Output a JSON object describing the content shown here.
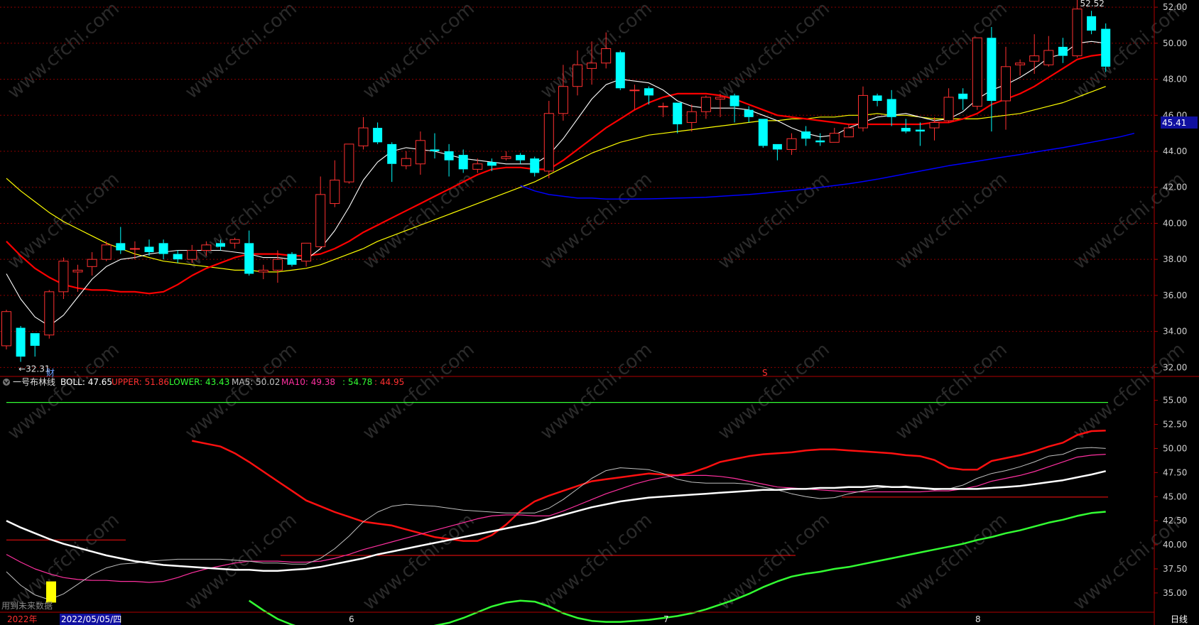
{
  "colors": {
    "background": "#000000",
    "up": "#ff3030",
    "down": "#00ffff",
    "grid": "#8b0000",
    "frame": "#b00000",
    "ma5": "#ffffff",
    "ma10": "#ff0000",
    "ma20": "#ffff00",
    "ma60": "#0000ff",
    "boll": "#ffffff",
    "upper": "#ff1010",
    "lower": "#33ff33",
    "bma5": "#c0c0c0",
    "bma10": "#ff30a0",
    "price_tag_bg": "#1010a0"
  },
  "watermark": "www.cfchi.com",
  "price_axis": {
    "ticks": [
      "32.00",
      "34.00",
      "36.00",
      "38.00",
      "40.00",
      "42.00",
      "44.00",
      "46.00",
      "48.00",
      "50.00",
      "52.00"
    ],
    "current_price": "45.41"
  },
  "boll_axis": {
    "ticks": [
      "35.00",
      "37.50",
      "40.00",
      "42.50",
      "45.00",
      "47.50",
      "50.00",
      "52.50",
      "55.00"
    ]
  },
  "annotations": {
    "high_label": "52.52",
    "low_label": "←32.31",
    "fin_marker": "财",
    "s_marker": "S"
  },
  "indicator_bar": {
    "name": "一号布林线",
    "boll": "BOLL: 47.65",
    "upper": "UPPER: 51.86",
    "lower": "LOWER: 43.43",
    "ma5": "MA5: 50.02",
    "ma10": "MA10: 49.38",
    "v1": ": 54.78",
    "v2": ": 44.95"
  },
  "bottom_axis": {
    "year_label": "2022年",
    "cursor_date": "2022/05/05/四",
    "months": [
      "6",
      "7",
      "8"
    ],
    "period": "日线",
    "overlay_text": "用到未来数据"
  },
  "chart_data": [
    {
      "type": "candlestick",
      "name": "main",
      "ylim": [
        31.5,
        52.4
      ],
      "candles": [
        [
          33.2,
          35.1,
          35.2,
          33.0
        ],
        [
          34.2,
          32.6,
          34.3,
          32.31
        ],
        [
          33.9,
          33.2,
          33.9,
          32.6
        ],
        [
          33.8,
          36.2,
          36.3,
          33.6
        ],
        [
          36.2,
          37.9,
          38.1,
          35.8
        ],
        [
          37.3,
          37.4,
          37.7,
          36.2
        ],
        [
          37.6,
          38.0,
          38.4,
          37.1
        ],
        [
          38.0,
          38.8,
          39.0,
          37.9
        ],
        [
          38.9,
          38.5,
          39.8,
          38.3
        ],
        [
          38.6,
          38.6,
          39.0,
          38.0
        ],
        [
          38.7,
          38.4,
          39.1,
          38.2
        ],
        [
          38.9,
          38.3,
          39.1,
          38.0
        ],
        [
          38.3,
          38.0,
          38.5,
          37.8
        ],
        [
          38.0,
          38.5,
          38.8,
          37.8
        ],
        [
          38.5,
          38.8,
          39.0,
          38.2
        ],
        [
          38.9,
          38.7,
          39.1,
          38.5
        ],
        [
          38.9,
          39.1,
          39.2,
          38.6
        ],
        [
          38.9,
          37.2,
          39.6,
          37.1
        ],
        [
          37.3,
          37.4,
          37.7,
          36.9
        ],
        [
          37.4,
          38.0,
          38.5,
          36.7
        ],
        [
          38.3,
          37.7,
          38.4,
          37.6
        ],
        [
          37.9,
          38.9,
          38.9,
          37.6
        ],
        [
          38.7,
          41.6,
          42.6,
          38.6
        ],
        [
          41.1,
          42.4,
          43.5,
          40.9
        ],
        [
          42.3,
          44.4,
          44.4,
          42.2
        ],
        [
          44.3,
          45.3,
          45.9,
          44.1
        ],
        [
          45.3,
          44.5,
          45.6,
          44.4
        ],
        [
          44.4,
          43.3,
          44.5,
          42.3
        ],
        [
          43.2,
          43.6,
          44.0,
          43.0
        ],
        [
          43.3,
          44.6,
          45.1,
          42.7
        ],
        [
          44.1,
          44.0,
          45.0,
          43.6
        ],
        [
          44.0,
          43.5,
          44.4,
          42.6
        ],
        [
          43.8,
          43.0,
          44.1,
          42.8
        ],
        [
          43.0,
          43.3,
          43.6,
          42.8
        ],
        [
          43.4,
          43.2,
          43.6,
          42.9
        ],
        [
          43.6,
          43.7,
          44.0,
          43.5
        ],
        [
          43.8,
          43.5,
          43.9,
          43.3
        ],
        [
          43.6,
          42.8,
          43.7,
          42.6
        ],
        [
          42.9,
          46.1,
          46.8,
          42.5
        ],
        [
          46.1,
          47.6,
          48.8,
          45.7
        ],
        [
          47.6,
          48.8,
          49.6,
          47.1
        ],
        [
          48.6,
          48.9,
          50.1,
          47.7
        ],
        [
          48.9,
          49.7,
          50.6,
          48.6
        ],
        [
          49.5,
          47.5,
          49.6,
          47.4
        ],
        [
          47.4,
          47.4,
          47.7,
          46.3
        ],
        [
          47.5,
          47.1,
          47.6,
          46.6
        ],
        [
          46.5,
          46.5,
          46.7,
          45.9
        ],
        [
          46.7,
          45.5,
          46.7,
          45.0
        ],
        [
          45.6,
          46.2,
          46.6,
          45.1
        ],
        [
          46.2,
          47.0,
          47.1,
          45.8
        ],
        [
          46.9,
          47.0,
          47.2,
          45.9
        ],
        [
          47.1,
          46.5,
          47.2,
          45.6
        ],
        [
          46.3,
          45.9,
          46.5,
          45.6
        ],
        [
          45.8,
          44.3,
          45.8,
          44.2
        ],
        [
          44.4,
          44.1,
          44.4,
          43.5
        ],
        [
          44.1,
          44.7,
          45.0,
          43.8
        ],
        [
          45.1,
          44.7,
          45.4,
          44.3
        ],
        [
          44.6,
          44.5,
          45.0,
          44.3
        ],
        [
          44.5,
          45.0,
          45.3,
          44.5
        ],
        [
          44.8,
          45.3,
          45.5,
          44.8
        ],
        [
          45.3,
          47.1,
          47.6,
          45.1
        ],
        [
          47.1,
          46.8,
          47.2,
          46.5
        ],
        [
          46.9,
          45.9,
          47.4,
          45.4
        ],
        [
          45.3,
          45.1,
          45.8,
          45.0
        ],
        [
          45.2,
          45.1,
          45.6,
          44.3
        ],
        [
          45.3,
          45.6,
          45.9,
          44.6
        ],
        [
          45.7,
          47.0,
          47.5,
          45.6
        ],
        [
          47.2,
          46.9,
          47.5,
          46.3
        ],
        [
          46.5,
          50.3,
          50.3,
          46.3
        ],
        [
          50.3,
          46.8,
          50.9,
          45.1
        ],
        [
          46.8,
          48.7,
          49.8,
          45.2
        ],
        [
          48.8,
          48.9,
          49.1,
          48.2
        ],
        [
          49.0,
          49.3,
          50.5,
          48.3
        ],
        [
          48.8,
          49.6,
          50.4,
          48.7
        ],
        [
          49.8,
          49.3,
          50.3,
          48.9
        ],
        [
          49.3,
          51.9,
          52.52,
          49.2
        ],
        [
          51.5,
          50.7,
          51.8,
          50.5
        ],
        [
          50.8,
          48.7,
          51.1,
          48.4
        ]
      ],
      "ma5": [
        37.2,
        35.8,
        34.8,
        34.3,
        34.9,
        35.9,
        36.9,
        37.6,
        38.0,
        38.1,
        38.3,
        38.4,
        38.5,
        38.5,
        38.5,
        38.5,
        38.4,
        38.3,
        38.1,
        38.1,
        38.0,
        38.0,
        38.6,
        39.6,
        40.9,
        42.4,
        43.4,
        44.0,
        44.2,
        44.1,
        44.0,
        43.8,
        43.6,
        43.5,
        43.4,
        43.3,
        43.3,
        43.3,
        43.8,
        44.7,
        45.8,
        46.9,
        47.7,
        48.0,
        47.9,
        47.8,
        47.4,
        46.8,
        46.5,
        46.4,
        46.4,
        46.4,
        46.3,
        46.0,
        45.7,
        45.3,
        45.0,
        44.8,
        44.9,
        45.3,
        45.6,
        45.9,
        46.0,
        46.1,
        45.9,
        45.7,
        45.8,
        46.2,
        46.9,
        47.4,
        47.7,
        48.1,
        48.6,
        49.2,
        49.4,
        50.0,
        50.1,
        50.0
      ],
      "ma10": [
        39.0,
        38.2,
        37.5,
        37.0,
        36.6,
        36.4,
        36.3,
        36.3,
        36.2,
        36.2,
        36.1,
        36.2,
        36.6,
        37.1,
        37.5,
        37.8,
        38.1,
        38.3,
        38.3,
        38.3,
        38.2,
        38.2,
        38.3,
        38.6,
        39.0,
        39.5,
        39.9,
        40.3,
        40.7,
        41.1,
        41.5,
        41.9,
        42.3,
        42.7,
        43.0,
        43.1,
        43.1,
        43.0,
        43.0,
        43.5,
        44.1,
        44.7,
        45.3,
        45.8,
        46.3,
        46.7,
        47.0,
        47.2,
        47.2,
        47.2,
        47.1,
        46.9,
        46.6,
        46.3,
        46.0,
        45.9,
        45.8,
        45.7,
        45.6,
        45.5,
        45.5,
        45.5,
        45.5,
        45.5,
        45.5,
        45.6,
        45.6,
        45.8,
        46.1,
        46.6,
        46.9,
        47.2,
        47.6,
        48.1,
        48.6,
        49.1,
        49.3,
        49.4
      ],
      "ma20": [
        42.5,
        41.8,
        41.2,
        40.6,
        40.1,
        39.7,
        39.3,
        38.9,
        38.6,
        38.3,
        38.1,
        37.9,
        37.8,
        37.7,
        37.6,
        37.5,
        37.4,
        37.4,
        37.3,
        37.3,
        37.4,
        37.5,
        37.7,
        38.0,
        38.3,
        38.6,
        39.0,
        39.3,
        39.6,
        39.9,
        40.2,
        40.5,
        40.8,
        41.1,
        41.4,
        41.7,
        42.0,
        42.3,
        42.7,
        43.1,
        43.5,
        43.9,
        44.2,
        44.5,
        44.7,
        44.9,
        45.0,
        45.1,
        45.2,
        45.3,
        45.4,
        45.5,
        45.6,
        45.7,
        45.7,
        45.8,
        45.8,
        45.9,
        45.9,
        46.0,
        46.0,
        46.1,
        46.0,
        46.0,
        45.9,
        45.8,
        45.8,
        45.8,
        45.8,
        45.9,
        46.0,
        46.1,
        46.3,
        46.5,
        46.7,
        47.0,
        47.3,
        47.6
      ],
      "ma60_start": 36,
      "ma60": [
        42.1,
        41.8,
        41.6,
        41.5,
        41.4,
        41.4,
        41.35,
        41.35,
        41.35,
        41.36,
        41.38,
        41.4,
        41.42,
        41.45,
        41.5,
        41.55,
        41.6,
        41.67,
        41.75,
        41.82,
        41.9,
        42.0,
        42.1,
        42.2,
        42.32,
        42.45,
        42.6,
        42.75,
        42.9,
        43.05,
        43.2,
        43.32,
        43.45,
        43.58,
        43.7,
        43.82,
        43.95,
        44.08,
        44.2,
        44.35,
        44.5,
        44.65,
        44.8,
        45.0
      ]
    },
    {
      "type": "line",
      "name": "boll",
      "ylim": [
        33.0,
        56.3
      ],
      "upper": [
        50.8,
        50.5,
        50.2,
        49.5,
        48.6,
        47.6,
        46.6,
        45.6,
        44.6,
        44.0,
        43.4,
        42.9,
        42.4,
        42.2,
        42.0,
        41.6,
        41.2,
        40.8,
        40.6,
        40.4,
        40.4,
        41.0,
        42.1,
        43.5,
        44.5,
        45.1,
        45.6,
        46.1,
        46.6,
        46.8,
        47.0,
        47.2,
        47.4,
        47.3,
        47.2,
        47.5,
        48.0,
        48.6,
        48.9,
        49.2,
        49.4,
        49.5,
        49.6,
        49.8,
        49.9,
        49.9,
        49.8,
        49.7,
        49.6,
        49.5,
        49.3,
        49.2,
        48.8,
        48.0,
        47.8,
        47.8,
        48.7,
        49.0,
        49.3,
        49.7,
        50.2,
        50.6,
        51.4,
        51.8,
        51.86
      ],
      "boll": [
        42.5,
        41.8,
        41.2,
        40.6,
        40.1,
        39.7,
        39.3,
        38.9,
        38.6,
        38.3,
        38.1,
        37.9,
        37.8,
        37.7,
        37.6,
        37.5,
        37.4,
        37.4,
        37.3,
        37.3,
        37.4,
        37.5,
        37.7,
        38.0,
        38.3,
        38.6,
        39.0,
        39.3,
        39.6,
        39.9,
        40.2,
        40.5,
        40.8,
        41.1,
        41.4,
        41.7,
        42.0,
        42.3,
        42.7,
        43.1,
        43.5,
        43.9,
        44.2,
        44.5,
        44.7,
        44.9,
        45.0,
        45.1,
        45.2,
        45.3,
        45.4,
        45.5,
        45.6,
        45.7,
        45.7,
        45.8,
        45.8,
        45.9,
        45.9,
        46.0,
        46.0,
        46.1,
        46.0,
        46.0,
        45.9,
        45.8,
        45.8,
        45.8,
        45.8,
        45.9,
        46.0,
        46.1,
        46.3,
        46.5,
        46.7,
        47.0,
        47.3,
        47.65
      ],
      "lower": [
        34.2,
        33.2,
        32.3,
        31.7,
        31.2,
        30.9,
        30.7,
        30.6,
        30.7,
        30.8,
        30.9,
        31.1,
        31.3,
        31.6,
        31.9,
        32.4,
        33.0,
        33.6,
        34.0,
        34.2,
        34.1,
        33.6,
        32.9,
        32.4,
        32.1,
        32.0,
        32.0,
        32.1,
        32.2,
        32.4,
        32.6,
        32.9,
        33.3,
        33.8,
        34.3,
        34.9,
        35.6,
        36.2,
        36.7,
        37.0,
        37.2,
        37.5,
        37.7,
        38.0,
        38.3,
        38.6,
        38.9,
        39.2,
        39.5,
        39.8,
        40.1,
        40.5,
        40.8,
        41.2,
        41.5,
        41.9,
        42.3,
        42.6,
        43.0,
        43.3,
        43.43
      ]
    }
  ]
}
